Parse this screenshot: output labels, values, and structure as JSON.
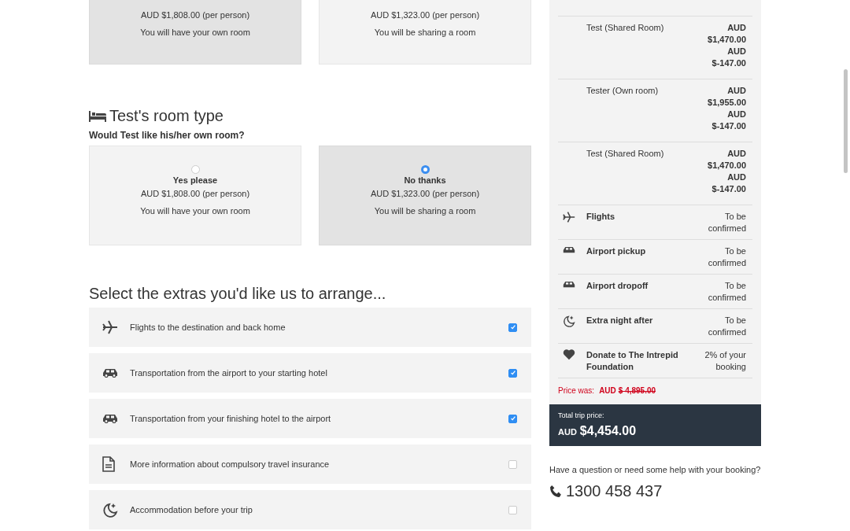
{
  "room_choices_top": {
    "options": [
      {
        "price": "AUD $1,808.00 (per person)",
        "note": "You will have your own room",
        "selected": true
      },
      {
        "price": "AUD $1,323.00 (per person)",
        "note": "You will be sharing a room",
        "selected": false
      }
    ]
  },
  "room_type_section": {
    "title": "Test's room type",
    "question": "Would Test like his/her own room?",
    "options": [
      {
        "label": "Yes please",
        "price": "AUD $1,808.00 (per person)",
        "note": "You will have your own room",
        "selected": false
      },
      {
        "label": "No thanks",
        "price": "AUD $1,323.00 (per person)",
        "note": "You will be sharing a room",
        "selected": true
      }
    ]
  },
  "extras": {
    "title": "Select the extras you'd like us to arrange...",
    "items": [
      {
        "kind": "plane",
        "label": "Flights to the destination and back home",
        "checked": true
      },
      {
        "kind": "car",
        "label": "Transportation from the airport to your starting hotel",
        "checked": true
      },
      {
        "kind": "car",
        "label": "Transportation from your finishing hotel to the airport",
        "checked": true
      },
      {
        "kind": "document",
        "label": "More information about compulsory travel insurance",
        "checked": false
      },
      {
        "kind": "moon",
        "label": "Accommodation before your trip",
        "checked": false
      }
    ]
  },
  "summary": {
    "room_rows": [
      {
        "name": "Test (Shared Room)",
        "amounts": [
          "AUD $1,470.00",
          "AUD $-147.00"
        ]
      },
      {
        "name": "Tester (Own room)",
        "amounts": [
          "AUD $1,955.00",
          "AUD $-147.00"
        ]
      },
      {
        "name": "Test (Shared Room)",
        "amounts": [
          "AUD $1,470.00",
          "AUD $-147.00"
        ]
      }
    ],
    "items": [
      {
        "kind": "plane",
        "label": "Flights",
        "value": "To be confirmed"
      },
      {
        "kind": "car",
        "label": "Airport pickup",
        "value": "To be confirmed"
      },
      {
        "kind": "car",
        "label": "Airport dropoff",
        "value": "To be confirmed"
      },
      {
        "kind": "moon",
        "label": "Extra night after",
        "value": "To be confirmed"
      },
      {
        "kind": "heart",
        "label": "Donate to The Intrepid Foundation",
        "value": "2% of your booking"
      }
    ],
    "price_was_label": "Price was:",
    "price_was_currency": "AUD",
    "price_was_amount": "$ 4,895.00",
    "total_label": "Total trip price:",
    "total_currency": "AUD",
    "total_amount": "$4,454.00"
  },
  "help": {
    "text": "Have a question or need some help with your booking?",
    "phone": "1300 458 437"
  }
}
